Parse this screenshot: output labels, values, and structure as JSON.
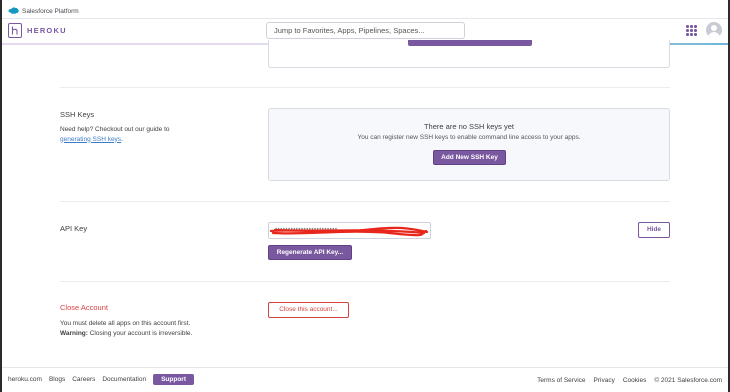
{
  "top_bar": {
    "brand": "Salesforce Platform"
  },
  "header": {
    "logo_text": "HEROKU",
    "search_placeholder": "Jump to Favorites, Apps, Pipelines, Spaces..."
  },
  "ssh_keys": {
    "title": "SSH Keys",
    "help_prefix": "Need help? Checkout out our guide to",
    "help_link": "generating SSH keys",
    "help_suffix": ".",
    "empty_title": "There are no SSH keys yet",
    "empty_subtitle": "You can register new SSH keys to enable command line access to your apps.",
    "add_button": "Add New SSH Key"
  },
  "api_key": {
    "title": "API Key",
    "value": "••••••••••••••••••••••••",
    "regenerate_button": "Regenerate API Key...",
    "hide_button": "Hide",
    "redaction_color": "#e8261b"
  },
  "close_account": {
    "title": "Close Account",
    "line1": "You must delete all apps on this account first.",
    "warning_label": "Warning:",
    "warning_text": "Closing your account is irreversible.",
    "button": "Close this account..."
  },
  "footer": {
    "left_links": [
      "heroku.com",
      "Blogs",
      "Careers",
      "Documentation"
    ],
    "support": "Support",
    "right_links": [
      "Terms of Service",
      "Privacy",
      "Cookies"
    ],
    "copyright": "© 2021 Salesforce.com"
  },
  "colors": {
    "brand_purple": "#79589f",
    "danger_red": "#d64242",
    "link_blue": "#3d7cc9",
    "salesforce_blue": "#1798c1"
  }
}
